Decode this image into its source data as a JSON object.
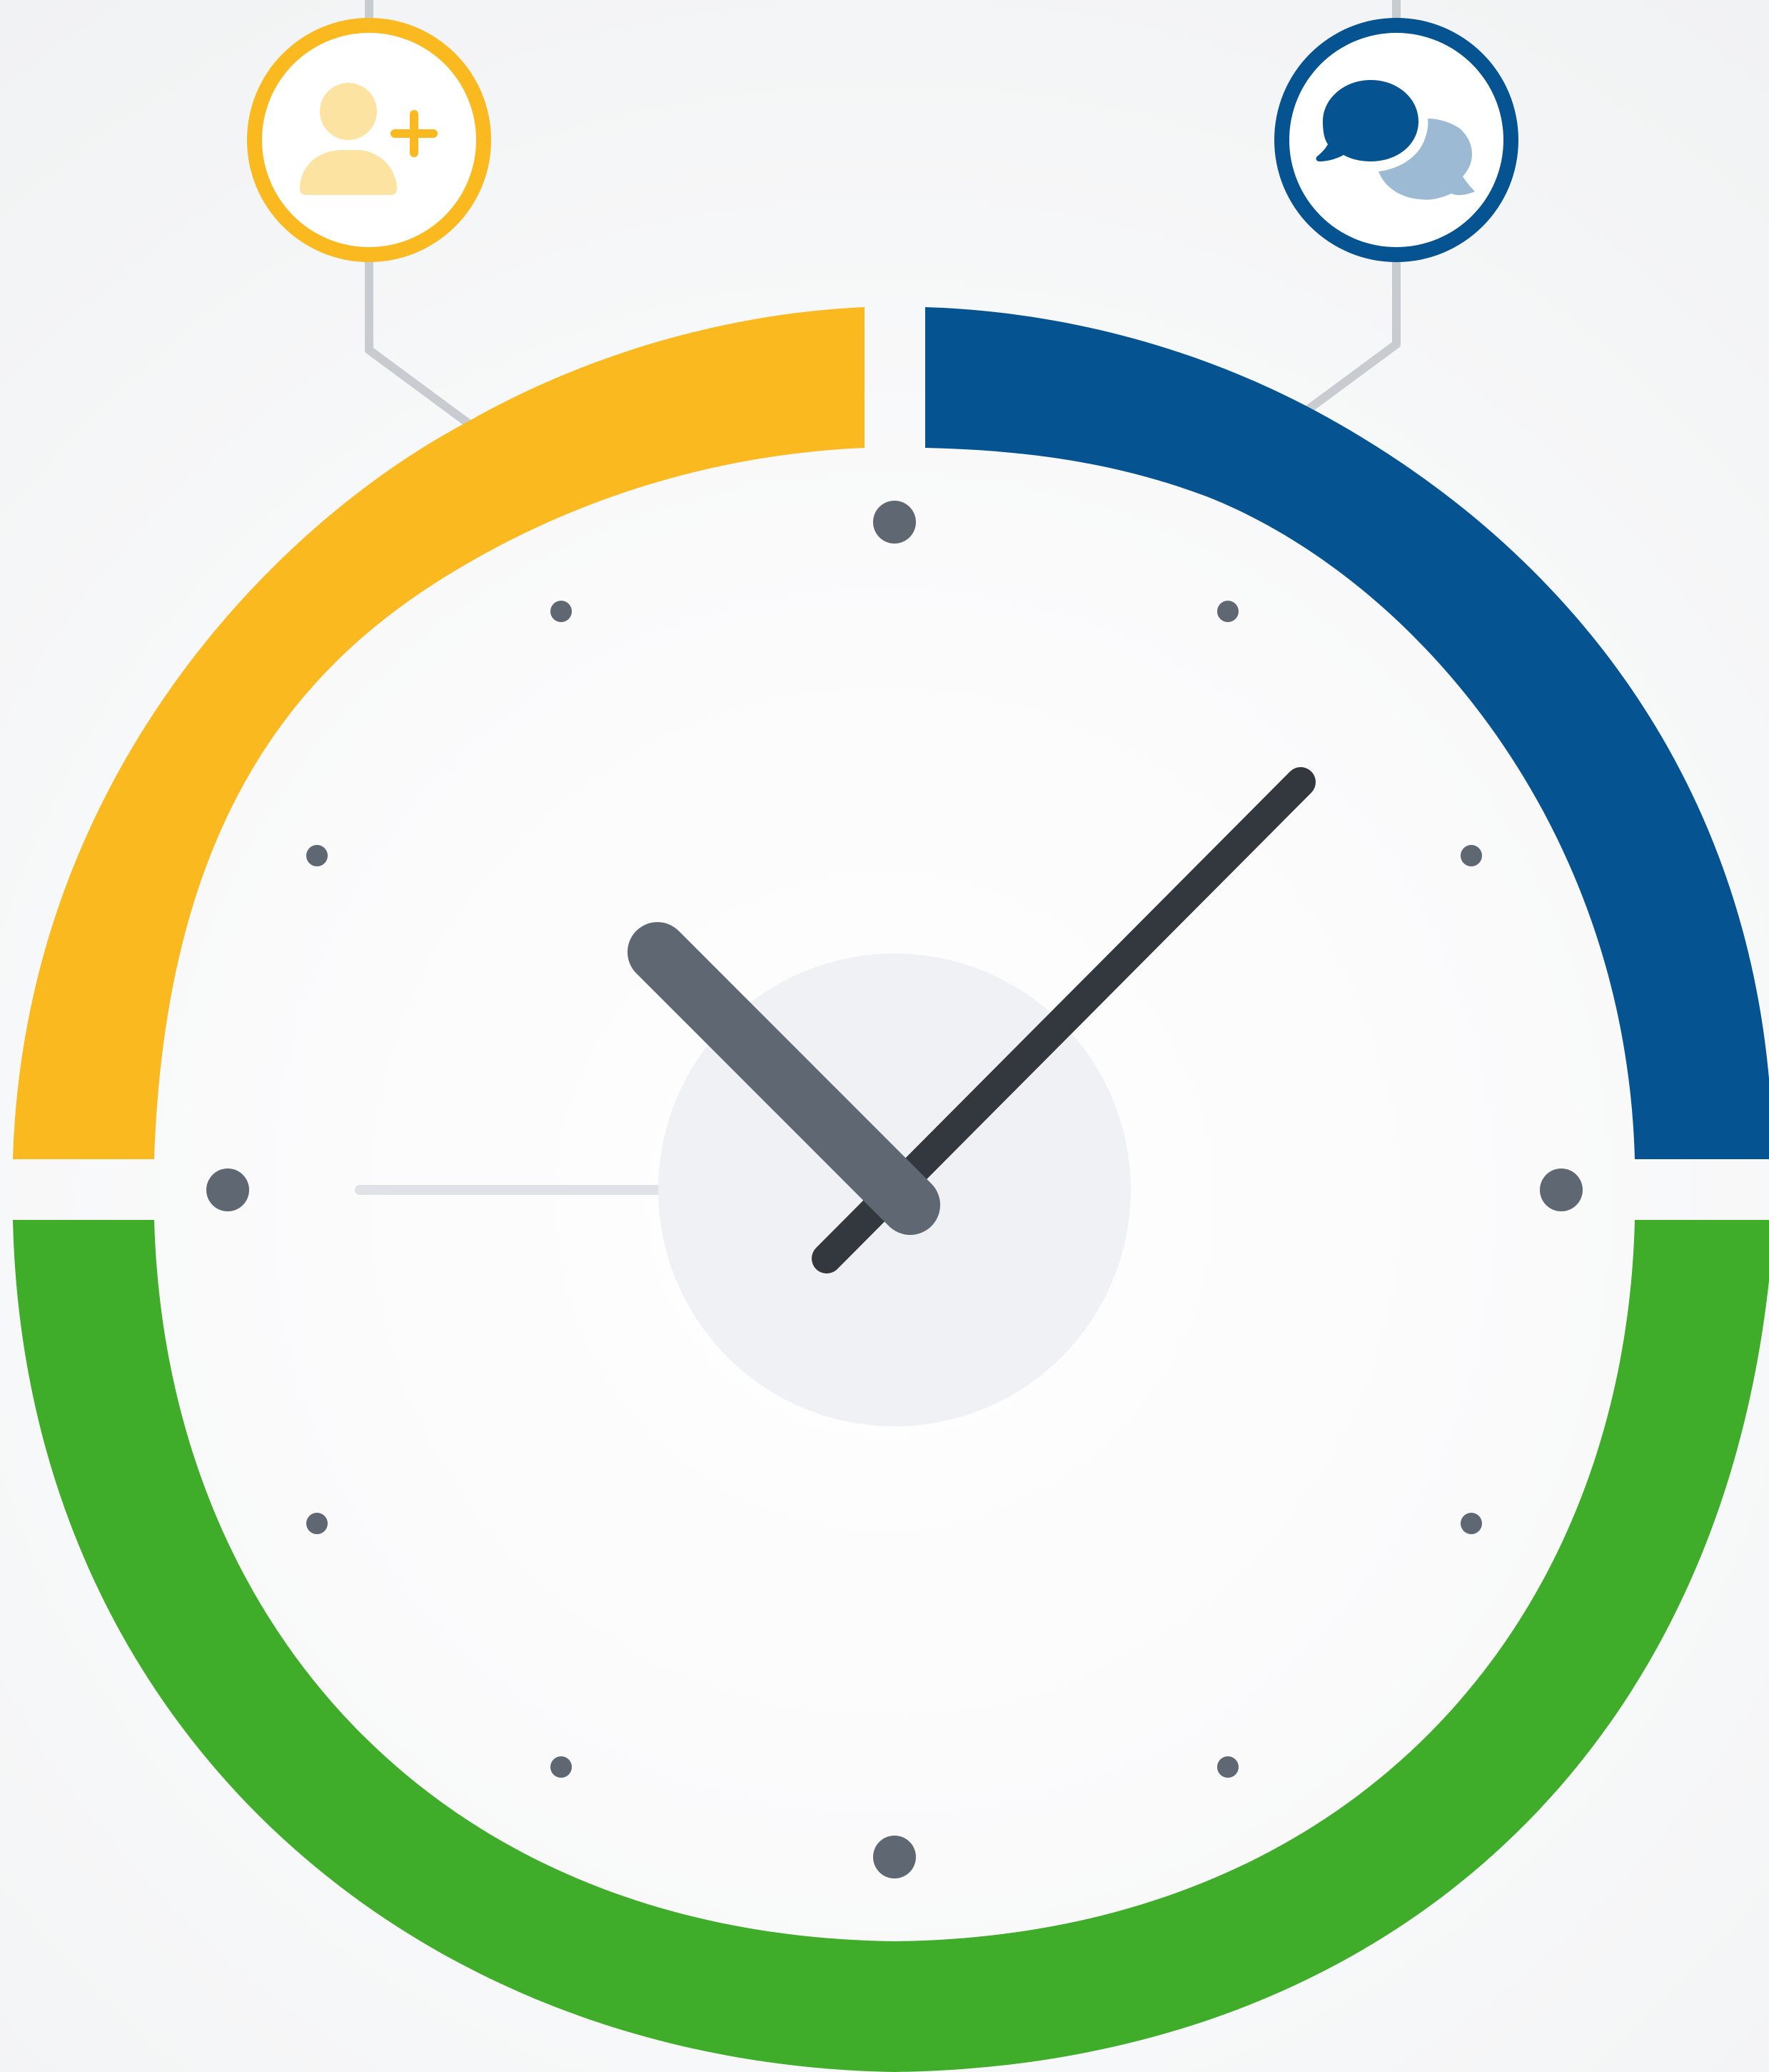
{
  "diagram": {
    "segments": [
      {
        "id": "onboarding",
        "color": "#f9b91f",
        "icon": "add-user-icon"
      },
      {
        "id": "communication",
        "color": "#055391",
        "icon": "chat-bubbles-icon"
      },
      {
        "id": "lower-arc",
        "color": "#3fac2a"
      }
    ],
    "clock": {
      "hour_hand_color": "#5f6872",
      "minute_hand_color": "#32383d",
      "second_hand_color": "#dfe3e7",
      "center_disc_color": "#f0f1f5",
      "major_tick_color": "#5f6872",
      "minor_tick_color": "#5f6872"
    },
    "connector_color": "#c8ccd1",
    "icon_colors": {
      "add_user_light": "#fde3a1",
      "add_user_accent": "#f9b91f",
      "chat_primary": "#055391",
      "chat_secondary": "#9dbad4"
    }
  }
}
